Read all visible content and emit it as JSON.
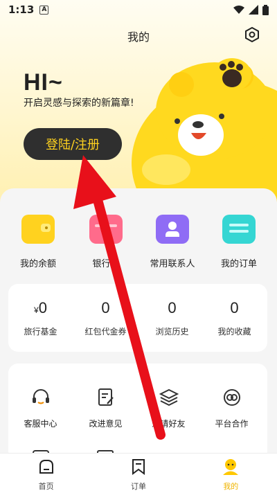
{
  "status_bar": {
    "time": "1:13",
    "notif": "A"
  },
  "header": {
    "title": "我的"
  },
  "hero": {
    "greeting": "HI~",
    "slogan": "开启灵感与探索的新篇章!",
    "login_label": "登陆/注册"
  },
  "quick_actions": [
    {
      "label": "我的余额",
      "icon": "wallet-icon",
      "color": "#ffd21f"
    },
    {
      "label": "银行卡",
      "icon": "bank-card-icon",
      "color": "#ff6b8b"
    },
    {
      "label": "常用联系人",
      "icon": "contacts-folder-icon",
      "color": "#8f6cf5"
    },
    {
      "label": "我的订单",
      "icon": "orders-icon",
      "color": "#35d6d3"
    }
  ],
  "stats": [
    {
      "prefix": "¥",
      "value": "0",
      "label": "旅行基金"
    },
    {
      "prefix": "",
      "value": "0",
      "label": "红包代金券"
    },
    {
      "prefix": "",
      "value": "0",
      "label": "浏览历史"
    },
    {
      "prefix": "",
      "value": "0",
      "label": "我的收藏"
    }
  ],
  "services": [
    {
      "label": "客服中心",
      "icon": "headset-icon"
    },
    {
      "label": "改进意见",
      "icon": "feedback-icon"
    },
    {
      "label": "邀请好友",
      "icon": "layers-icon"
    },
    {
      "label": "平台合作",
      "icon": "partnership-icon"
    }
  ],
  "tabbar": [
    {
      "label": "首页",
      "icon": "home-icon"
    },
    {
      "label": "订单",
      "icon": "bookmark-icon"
    },
    {
      "label": "我的",
      "icon": "profile-icon",
      "active": true
    }
  ],
  "colors": {
    "accent": "#ffd21f",
    "button_bg": "#2f2f2f",
    "arrow": "#e8101a"
  }
}
